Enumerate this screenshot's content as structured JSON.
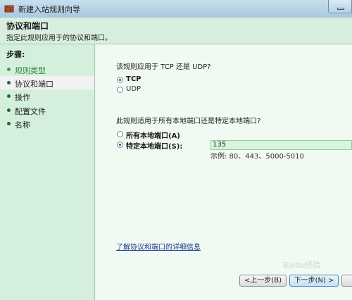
{
  "window": {
    "title": "新建入站规则向导"
  },
  "header": {
    "title": "协议和端口",
    "subtitle": "指定此规则应用于的协议和端口。"
  },
  "steps": {
    "title": "步骤:",
    "items": [
      {
        "label": "规则类型",
        "state": "done"
      },
      {
        "label": "协议和端口",
        "state": "current"
      },
      {
        "label": "操作",
        "state": "todo"
      },
      {
        "label": "配置文件",
        "state": "todo"
      },
      {
        "label": "名称",
        "state": "todo"
      }
    ]
  },
  "protocol": {
    "question": "该规则应用于 TCP 还是 UDP?",
    "options": [
      {
        "label": "TCP",
        "selected": true
      },
      {
        "label": "UDP",
        "selected": false
      }
    ]
  },
  "ports": {
    "question": "此规则适用于所有本地端口还是特定本地端口?",
    "options": [
      {
        "label": "所有本地端口(A)",
        "selected": false
      },
      {
        "label": "特定本地端口(S):",
        "selected": true
      }
    ],
    "value": "135",
    "example": "示例: 80、443、5000-5010"
  },
  "link": {
    "label": "了解协议和端口的详细信息"
  },
  "buttons": {
    "back": "<上一步(B)",
    "next": "下一步(N) >"
  },
  "watermark": "Baidu经验"
}
